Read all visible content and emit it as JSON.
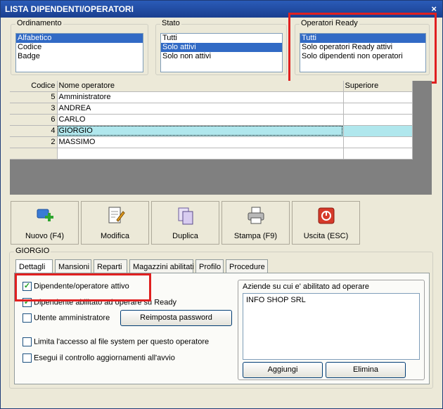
{
  "window": {
    "title": "LISTA DIPENDENTI/OPERATORI",
    "close_glyph": "×"
  },
  "ordinamento": {
    "title": "Ordinamento",
    "items": [
      "Alfabetico",
      "Codice",
      "Badge"
    ],
    "selected_index": 0
  },
  "stato": {
    "title": "Stato",
    "items": [
      "Tutti",
      "Solo attivi",
      "Solo non attivi"
    ],
    "selected_index": 1
  },
  "operatori_ready": {
    "title": "Operatori Ready",
    "items": [
      "Tutti",
      "Solo operatori Ready attivi",
      "Solo dipendenti non operatori"
    ],
    "selected_index": 0
  },
  "grid": {
    "columns": [
      "Codice",
      "Nome operatore",
      "Superiore"
    ],
    "rows": [
      {
        "code": "5",
        "name": "Amministratore",
        "sup": ""
      },
      {
        "code": "3",
        "name": "ANDREA",
        "sup": ""
      },
      {
        "code": "6",
        "name": "CARLO",
        "sup": ""
      },
      {
        "code": "4",
        "name": "GIORGIO",
        "sup": ""
      },
      {
        "code": "2",
        "name": "MASSIMO",
        "sup": ""
      }
    ],
    "selected_index": 3
  },
  "toolbar": {
    "new_label": "Nuovo (F4)",
    "edit_label": "Modifica",
    "duplicate_label": "Duplica",
    "print_label": "Stampa (F9)",
    "exit_label": "Uscita (ESC)"
  },
  "detail": {
    "title": "GIORGIO",
    "tabs": [
      "Dettagli",
      "Mansioni",
      "Reparti",
      "Magazzini abilitati",
      "Profilo",
      "Procedure"
    ],
    "active_tab": 0,
    "checkboxes": {
      "active": {
        "label": "Dipendente/operatore attivo",
        "checked": true
      },
      "ready": {
        "label": "Dipendente abilitato ad operare su Ready",
        "checked": true
      },
      "admin": {
        "label": "Utente amministratore",
        "checked": false
      },
      "fs_limit": {
        "label": "Limita l'accesso al file system per questo operatore",
        "checked": false
      },
      "updates": {
        "label": "Esegui il controllo aggiornamenti all'avvio",
        "checked": false
      }
    },
    "reset_password_label": "Reimposta password",
    "companies": {
      "title": "Aziende su cui e' abilitato ad operare",
      "items": [
        "INFO SHOP SRL"
      ]
    },
    "add_label": "Aggiungi",
    "remove_label": "Elimina"
  },
  "colors": {
    "title_bar": "#1a3f8f",
    "selection": "#316ac5",
    "grid_selection": "#b0e7ed",
    "highlight_box": "#e02020"
  },
  "icons": [
    "new-user-icon",
    "edit-document-icon",
    "duplicate-icon",
    "printer-icon",
    "exit-icon"
  ]
}
